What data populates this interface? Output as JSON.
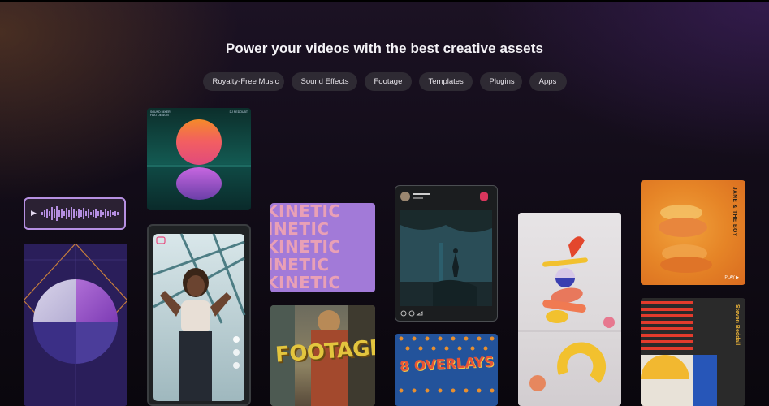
{
  "hero": {
    "headline": "Power your videos with the best creative assets"
  },
  "categories": [
    {
      "label": "Royalty-Free Music"
    },
    {
      "label": "Sound Effects"
    },
    {
      "label": "Footage"
    },
    {
      "label": "Templates"
    },
    {
      "label": "Plugins"
    },
    {
      "label": "Apps"
    }
  ],
  "cards": {
    "album_caption_left": "SOUND MIXER\nFLAT DESIGN",
    "album_caption_right": "DJ REDOUBT",
    "kinetic_text": "KINETIC",
    "footage_text": "FOOTAGE",
    "overlays_text": "8 OVERLAYS",
    "lips_title": "JANE & THE BOY",
    "lips_play": "PLAY ▶",
    "poster_name": "Steven Beddall"
  },
  "colors": {
    "accent": "#b690e2",
    "chip_bg": "#2e2a33",
    "page_bg": "#0b0710"
  },
  "icons": [
    "play-icon",
    "waveform-icon",
    "instagram-icon",
    "heart-icon",
    "comment-icon",
    "share-icon"
  ]
}
